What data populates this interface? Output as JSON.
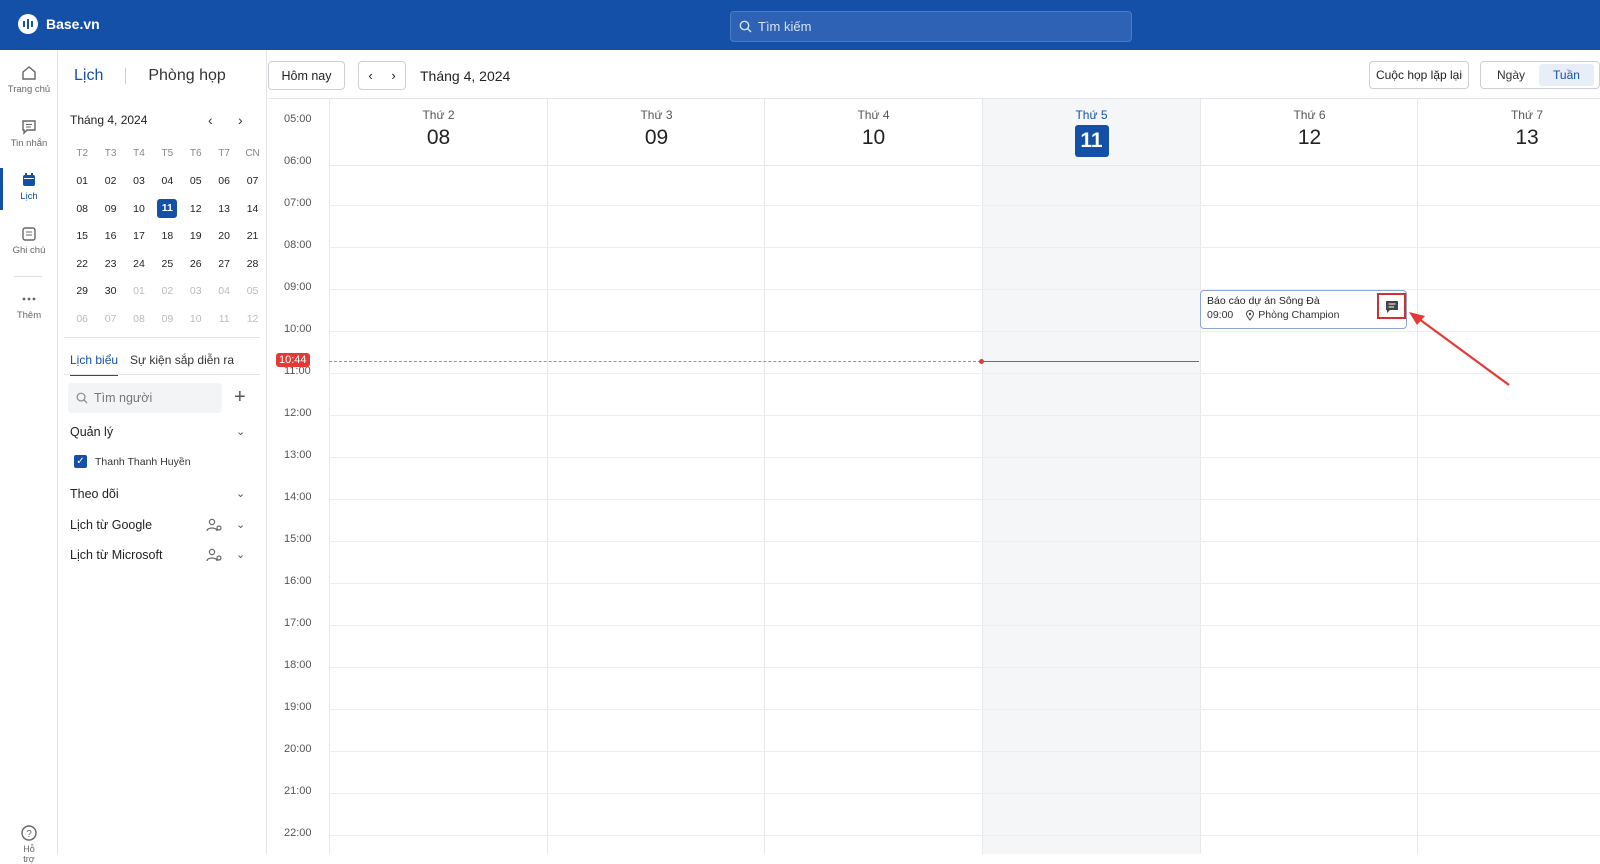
{
  "app": {
    "name": "Base.vn"
  },
  "search": {
    "placeholder": "Tìm kiếm"
  },
  "rail": [
    {
      "label": "Trang chủ"
    },
    {
      "label": "Tin nhắn"
    },
    {
      "label": "Lịch"
    },
    {
      "label": "Ghi chú"
    },
    {
      "label": "Thêm"
    },
    {
      "label": "Hỗ trợ"
    }
  ],
  "side": {
    "tab_calendar": "Lịch",
    "tab_rooms": "Phòng họp",
    "mini_month": "Tháng 4, 2024",
    "weekdays": [
      "T2",
      "T3",
      "T4",
      "T5",
      "T6",
      "T7",
      "CN"
    ],
    "weeks": [
      [
        "01",
        "02",
        "03",
        "04",
        "05",
        "06",
        "07"
      ],
      [
        "08",
        "09",
        "10",
        "11",
        "12",
        "13",
        "14"
      ],
      [
        "15",
        "16",
        "17",
        "18",
        "19",
        "20",
        "21"
      ],
      [
        "22",
        "23",
        "24",
        "25",
        "26",
        "27",
        "28"
      ],
      [
        "29",
        "30",
        "01",
        "02",
        "03",
        "04",
        "05"
      ],
      [
        "06",
        "07",
        "08",
        "09",
        "10",
        "11",
        "12"
      ]
    ],
    "tab_schedule": "Lịch biểu",
    "tab_upcoming": "Sự kiện sắp diễn ra",
    "people_placeholder": "Tìm người",
    "group_manage": "Quản lý",
    "person_name": "Thanh Thanh Huyền",
    "group_follow": "Theo dõi",
    "group_google": "Lịch từ Google",
    "group_microsoft": "Lịch từ Microsoft"
  },
  "toolbar": {
    "today": "Hôm nay",
    "month": "Tháng 4, 2024",
    "recurring": "Cuộc họp lặp lại",
    "view_day": "Ngày",
    "view_week": "Tuần"
  },
  "week": {
    "days": [
      {
        "name": "Thứ 2",
        "num": "08"
      },
      {
        "name": "Thứ 3",
        "num": "09"
      },
      {
        "name": "Thứ 4",
        "num": "10"
      },
      {
        "name": "Thứ 5",
        "num": "11"
      },
      {
        "name": "Thứ 6",
        "num": "12"
      },
      {
        "name": "Thứ 7",
        "num": "13"
      }
    ],
    "times": [
      "05:00",
      "06:00",
      "07:00",
      "08:00",
      "09:00",
      "10:00",
      "11:00",
      "12:00",
      "13:00",
      "14:00",
      "15:00",
      "16:00",
      "17:00",
      "18:00",
      "19:00",
      "20:00",
      "21:00",
      "22:00"
    ],
    "now": "10:44"
  },
  "event": {
    "title": "Báo cáo dự án Sông Đà",
    "time": "09:00",
    "room": "Phòng Champion"
  },
  "colors": {
    "brand": "#1450a8",
    "now": "#e53935",
    "highlight": "#d32f2f"
  }
}
